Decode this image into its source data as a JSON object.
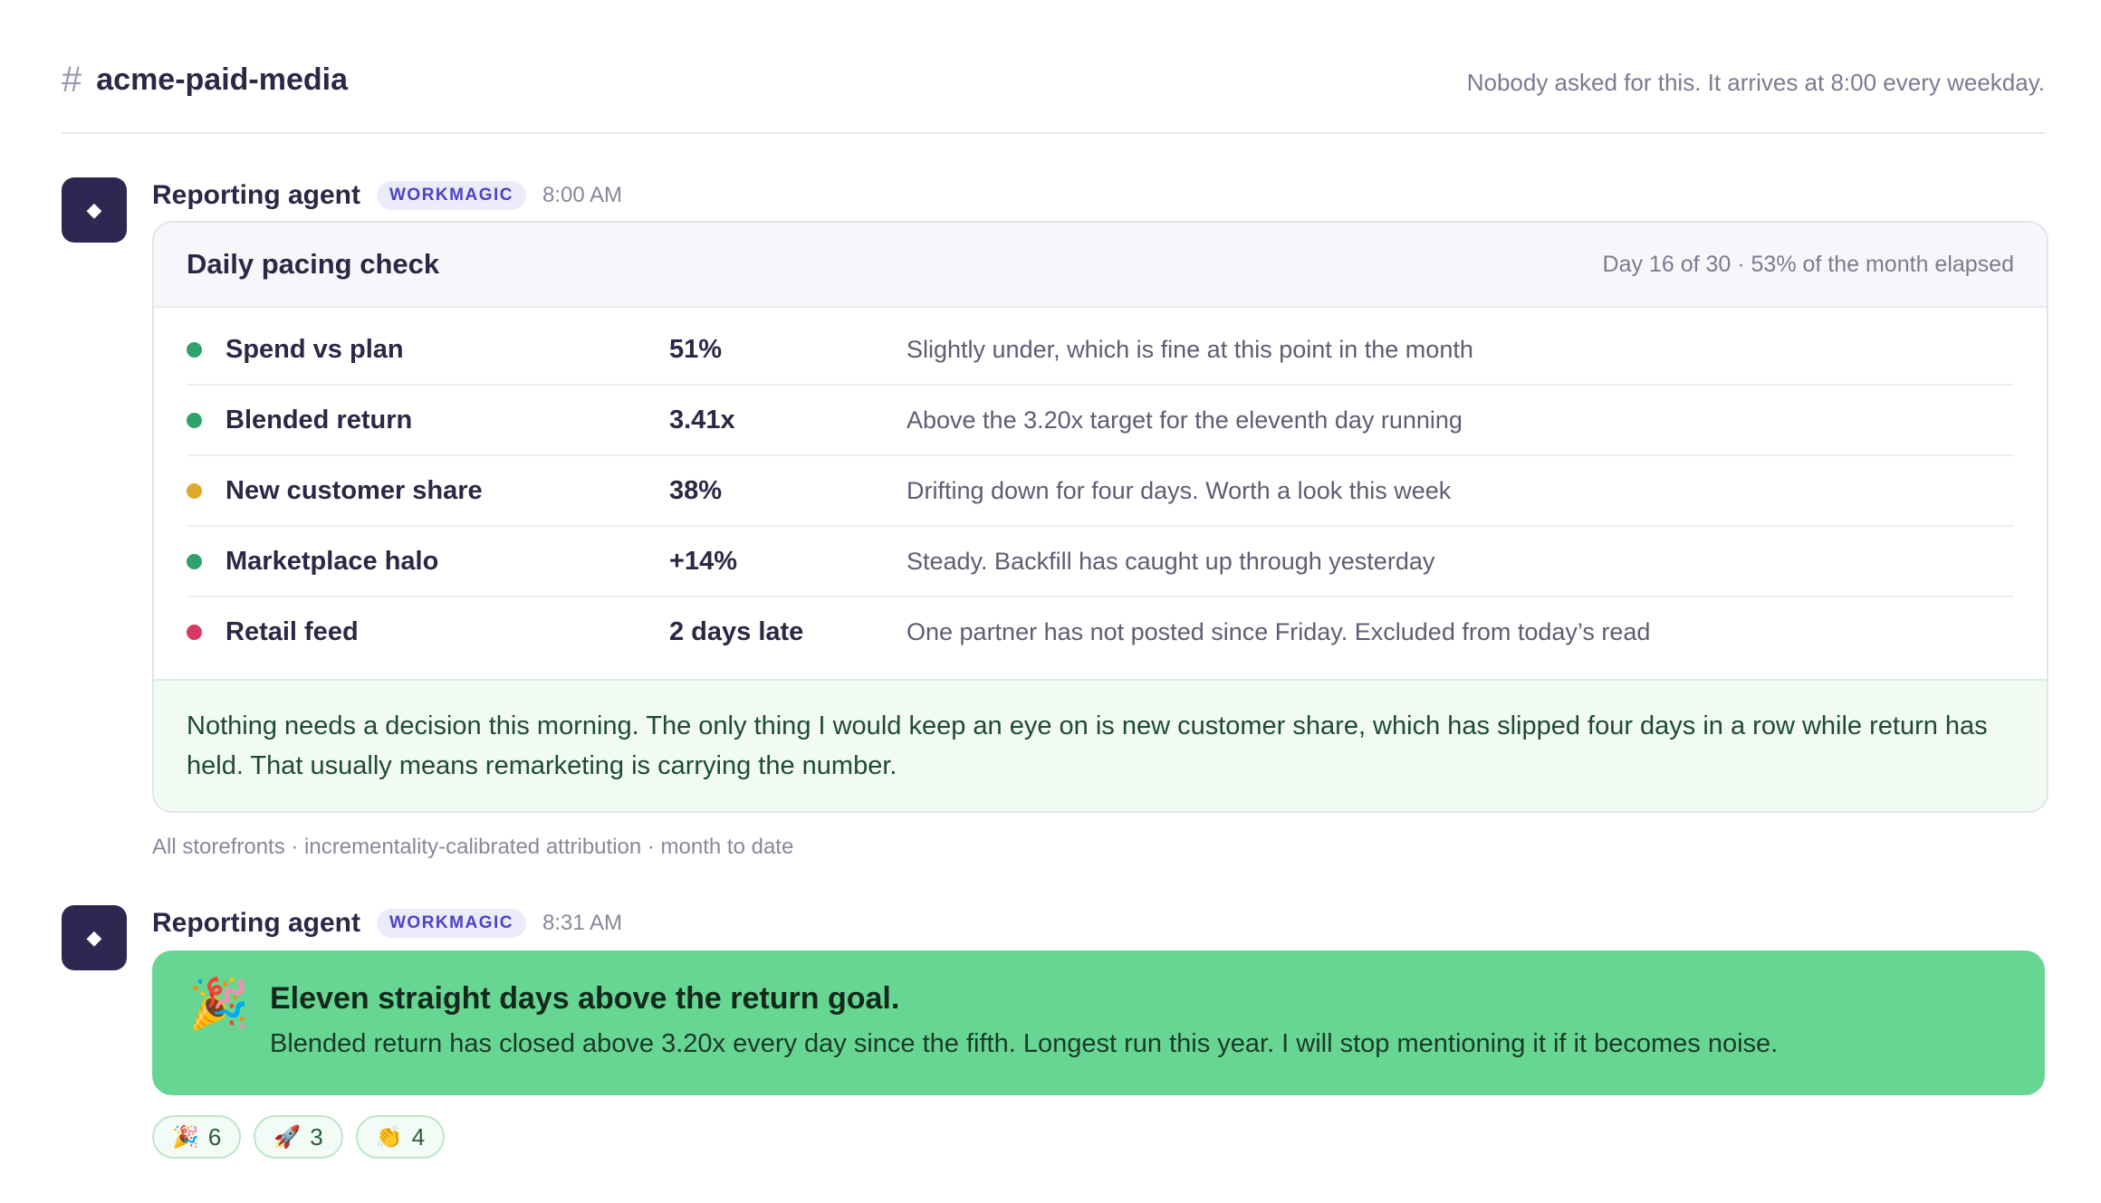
{
  "channel": {
    "name": "acme-paid-media",
    "note": "Nobody asked for this. It arrives at 8:00 every weekday."
  },
  "messages": [
    {
      "sender": "Reporting agent",
      "badge": "WORKMAGIC",
      "time": "8:00 AM",
      "avatar_icon": "diamond-icon",
      "card": {
        "title": "Daily pacing check",
        "subtitle": "Day 16 of 30 · 53% of the month elapsed",
        "rows": [
          {
            "metric": "Spend vs plan",
            "value": "51%",
            "note": "Slightly under, which is fine at this point in the month",
            "status_color": "#2ea36b"
          },
          {
            "metric": "Blended return",
            "value": "3.41x",
            "note": "Above the 3.20x target for the eleventh day running",
            "status_color": "#2ea36b"
          },
          {
            "metric": "New customer share",
            "value": "38%",
            "note": "Drifting down for four days. Worth a look this week",
            "status_color": "#e0a92c"
          },
          {
            "metric": "Marketplace halo",
            "value": "+14%",
            "note": "Steady. Backfill has caught up through yesterday",
            "status_color": "#2ea36b"
          },
          {
            "metric": "Retail feed",
            "value": "2 days late",
            "note": "One partner has not posted since Friday. Excluded from today’s read",
            "status_color": "#d93a63"
          }
        ],
        "summary": "Nothing needs a decision this morning. The only thing I would keep an eye on is new customer share, which has slipped four days in a row while return has held. That usually means remarketing is carrying the number."
      },
      "footnote": "All storefronts · incrementality-calibrated attribution · month to date"
    },
    {
      "sender": "Reporting agent",
      "badge": "WORKMAGIC",
      "time": "8:31 AM",
      "avatar_icon": "diamond-icon",
      "banner": {
        "emoji": "🎉",
        "title": "Eleven straight days above the return goal.",
        "description": "Blended return has closed above 3.20x every day since the fifth. Longest run this year. I will stop mentioning it if it becomes noise."
      },
      "reactions": [
        {
          "emoji": "🎉",
          "count": "6"
        },
        {
          "emoji": "🚀",
          "count": "3"
        },
        {
          "emoji": "👏",
          "count": "4"
        }
      ]
    }
  ]
}
